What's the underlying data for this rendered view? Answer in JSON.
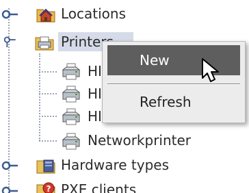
{
  "tree": {
    "items": [
      {
        "label": "Locations",
        "icon": "house-folder-icon",
        "expanded": false
      },
      {
        "label": "Printers",
        "icon": "printer-folder-icon",
        "expanded": true,
        "selected": true
      },
      {
        "label": "HI",
        "icon": "printer-icon"
      },
      {
        "label": "HI",
        "icon": "printer-icon"
      },
      {
        "label": "HI",
        "icon": "printer-icon"
      },
      {
        "label": "Networkprinter",
        "icon": "printer-icon"
      },
      {
        "label": "Hardware types",
        "icon": "hardware-folder-icon",
        "expanded": false
      },
      {
        "label": "PXE clients",
        "icon": "pxe-folder-icon",
        "expanded": false
      }
    ]
  },
  "context_menu": {
    "items": [
      {
        "label": "New",
        "highlighted": true
      },
      {
        "label": "Refresh",
        "highlighted": false
      }
    ]
  },
  "colors": {
    "selection": "#d5dbe8",
    "menu_background": "#ececec",
    "menu_highlight": "#5e5e5e",
    "tree_line": "#9aa3b5",
    "handle": "#3b5b8f"
  }
}
